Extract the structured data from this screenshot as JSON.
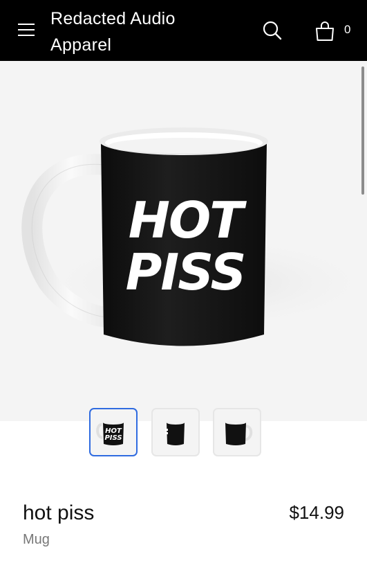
{
  "header": {
    "store_title": "Redacted Audio Apparel",
    "cart_count": "0",
    "icons": {
      "menu": "hamburger-menu-icon",
      "search": "search-icon",
      "cart": "shopping-bag-icon"
    }
  },
  "product": {
    "mug_print": [
      "HOT",
      "PISS"
    ],
    "thumbnails": [
      {
        "label": "front view",
        "print": [
          "HOT",
          "PISS"
        ],
        "selected": true
      },
      {
        "label": "side view",
        "selected": false
      },
      {
        "label": "back view",
        "selected": false
      }
    ],
    "name": "hot piss",
    "type": "Mug",
    "price": "$14.99"
  },
  "colors": {
    "header_bg": "#000000",
    "selected_thumb_border": "#2f6be0",
    "hero_bg": "#f4f4f4"
  }
}
